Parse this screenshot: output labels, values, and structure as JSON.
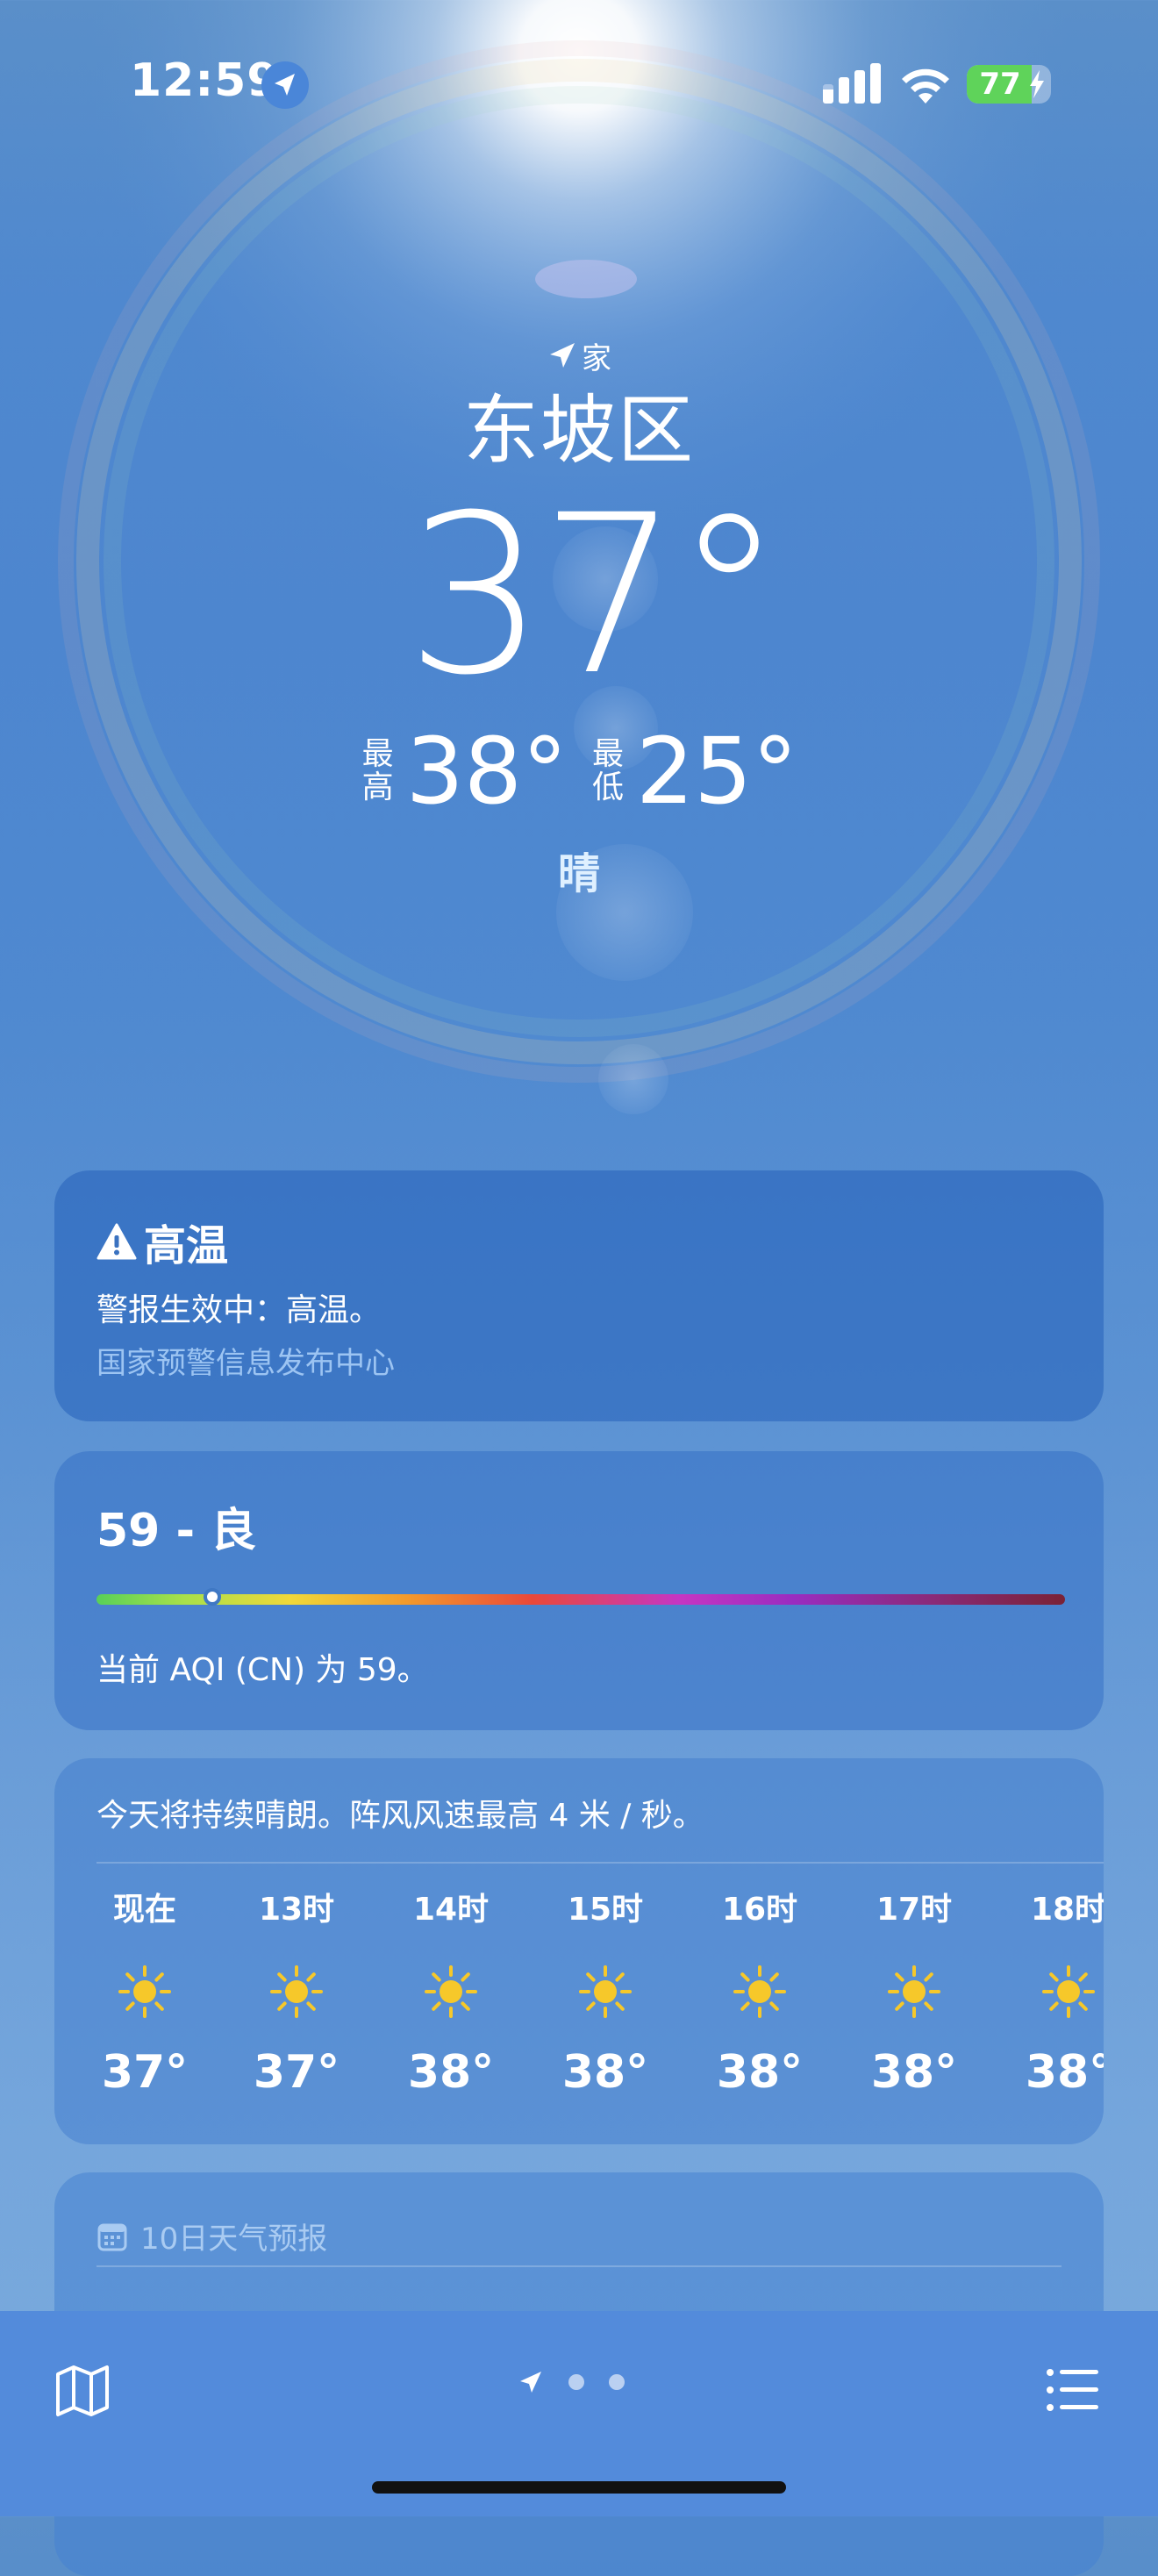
{
  "status_bar": {
    "time": "12:59",
    "battery": "77",
    "battery_level": 0.77,
    "icons": [
      "location-arrow-icon",
      "cellular-signal-icon",
      "wifi-icon",
      "battery-charging-icon"
    ]
  },
  "header": {
    "home_label": "家",
    "city": "东坡区",
    "current_temp": "37°",
    "high_label": "最高",
    "high_value": "38°",
    "low_label": "最低",
    "low_value": "25°",
    "condition": "晴"
  },
  "alert": {
    "icon": "warning-icon",
    "title": "高温",
    "body": "警报生效中：高温。",
    "source": "国家预警信息发布中心"
  },
  "aqi": {
    "value_text": "59 - 良",
    "level": 0.12,
    "description": "当前 AQI (CN) 为 59。"
  },
  "hourly": {
    "summary": "今天将持续晴朗。阵风风速最高 4 米 / 秒。",
    "hours": [
      {
        "label": "现在",
        "icon": "sun-icon",
        "temp": "37°"
      },
      {
        "label": "13时",
        "icon": "sun-icon",
        "temp": "37°"
      },
      {
        "label": "14时",
        "icon": "sun-icon",
        "temp": "38°"
      },
      {
        "label": "15时",
        "icon": "sun-icon",
        "temp": "38°"
      },
      {
        "label": "16时",
        "icon": "sun-icon",
        "temp": "38°"
      },
      {
        "label": "17时",
        "icon": "sun-icon",
        "temp": "38°"
      },
      {
        "label": "18时",
        "icon": "sun-icon",
        "temp": "38°"
      }
    ]
  },
  "daily": {
    "icon": "calendar-icon",
    "title": "10日天气预报"
  },
  "bottom_bar": {
    "icons": [
      "map-icon",
      "location-arrow-icon",
      "page-dot",
      "page-dot",
      "list-icon"
    ]
  },
  "colors": {
    "sky_top": "#5a8fc9",
    "sky_bottom": "#7aaadd",
    "sun_yellow": "#f6c82a",
    "alert_source": "#9cc4f2",
    "battery_green": "#5fd35a"
  }
}
